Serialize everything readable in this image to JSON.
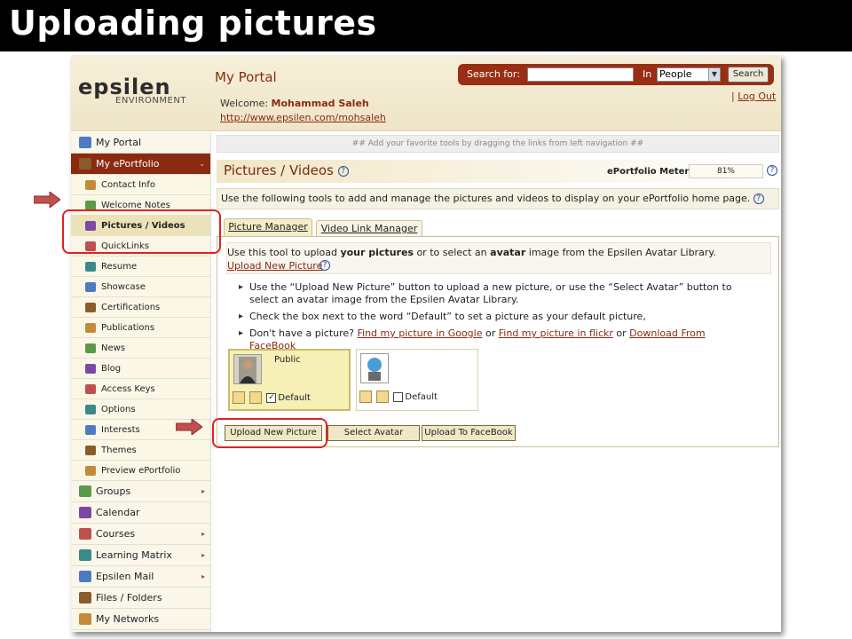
{
  "banner": {
    "title": "Uploading pictures"
  },
  "header": {
    "logo": "epsilen",
    "logo_sub": "ENVIRONMENT",
    "portal_title": "My Portal",
    "welcome_label": "Welcome:",
    "welcome_name": "Mohammad Saleh",
    "welcome_url": "http://www.epsilen.com/mohsaleh",
    "search_label": "Search for:",
    "in_label": "In",
    "in_selected": "People",
    "search_button": "Search",
    "logout": "Log Out"
  },
  "sidebar": {
    "items": [
      {
        "label": "My Portal",
        "icon": "portal-icon",
        "type": "top"
      },
      {
        "label": "My ePortfolio",
        "icon": "portfolio-icon",
        "type": "active"
      },
      {
        "label": "Contact Info",
        "icon": "contact-card-icon",
        "type": "sub"
      },
      {
        "label": "Welcome Notes",
        "icon": "welcome-note-icon",
        "type": "sub"
      },
      {
        "label": "Pictures / Videos",
        "icon": "pictures-icon",
        "type": "selected"
      },
      {
        "label": "QuickLinks",
        "icon": "quicklinks-icon",
        "type": "sub"
      },
      {
        "label": "Resume",
        "icon": "resume-icon",
        "type": "sub"
      },
      {
        "label": "Showcase",
        "icon": "showcase-icon",
        "type": "sub"
      },
      {
        "label": "Certifications",
        "icon": "certificate-icon",
        "type": "sub"
      },
      {
        "label": "Publications",
        "icon": "publications-icon",
        "type": "sub"
      },
      {
        "label": "News",
        "icon": "news-icon",
        "type": "sub"
      },
      {
        "label": "Blog",
        "icon": "blog-icon",
        "type": "sub"
      },
      {
        "label": "Access Keys",
        "icon": "folder-key-icon",
        "type": "sub"
      },
      {
        "label": "Options",
        "icon": "options-icon",
        "type": "sub"
      },
      {
        "label": "Interests",
        "icon": "globe-icon",
        "type": "sub"
      },
      {
        "label": "Themes",
        "icon": "themes-icon",
        "type": "sub"
      },
      {
        "label": "Preview ePortfolio",
        "icon": "preview-icon",
        "type": "sub"
      },
      {
        "label": "Groups",
        "icon": "groups-icon",
        "type": "top"
      },
      {
        "label": "Calendar",
        "icon": "calendar-icon",
        "type": "top"
      },
      {
        "label": "Courses",
        "icon": "courses-icon",
        "type": "top"
      },
      {
        "label": "Learning Matrix",
        "icon": "matrix-icon",
        "type": "top"
      },
      {
        "label": "Epsilen Mail",
        "icon": "mail-icon",
        "type": "top"
      },
      {
        "label": "Files / Folders",
        "icon": "folder-icon",
        "type": "top"
      },
      {
        "label": "My Networks",
        "icon": "networks-icon",
        "type": "top"
      }
    ]
  },
  "main": {
    "hint": "## Add your favorite tools by dragging the links from left navigation ##",
    "page_title": "Pictures / Videos",
    "meter_label": "ePortfolio Meter:",
    "meter_value": "81%",
    "description": "Use the following tools to add and manage the pictures and videos to display on your ePortfolio home page.",
    "tabs": [
      "Picture Manager",
      "Video Link Manager"
    ],
    "info_line1_a": "Use this tool to upload ",
    "info_line1_b": "your pictures",
    "info_line1_c": " or to select an ",
    "info_line1_d": "avatar",
    "info_line1_e": " image from the Epsilen Avatar Library.",
    "upload_link": "Upload New Picture",
    "bullet1": "Use the “Upload New Picture” button to upload a new picture, or use the “Select Avatar” button to select an avatar image from the Epsilen Avatar Library.",
    "bullet2": "Check the box next to the word “Default” to set a picture as your default picture,",
    "bullet3_prefix": "Don't have a picture?",
    "bullet3_link1": "Find my picture in Google",
    "bullet3_or1": "or",
    "bullet3_link2": "Find my picture in flickr",
    "bullet3_or2": "or",
    "bullet3_link3": "Download From FaceBook",
    "card1_label": "Public",
    "card1_default": "Default",
    "card2_default": "Default",
    "btn_upload": "Upload New Picture",
    "btn_avatar": "Select Avatar",
    "btn_facebook": "Upload To FaceBook"
  },
  "colors": {
    "accent": "#8a2a10",
    "highlight": "#e0231d",
    "arrow": "#c0504d"
  }
}
